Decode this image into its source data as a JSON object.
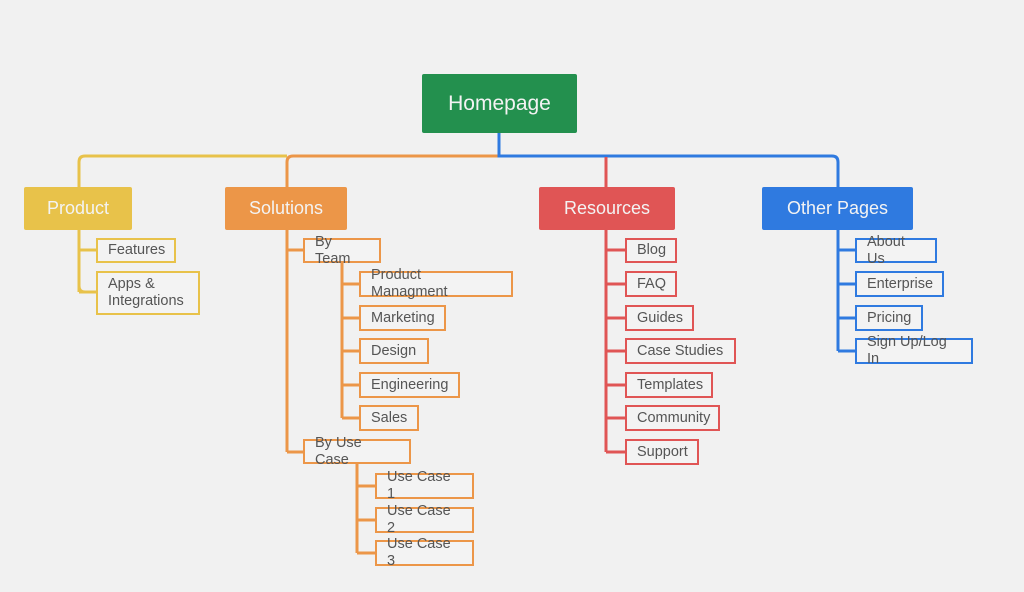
{
  "root": {
    "label": "Homepage",
    "color": "#23904e"
  },
  "branches": [
    {
      "label": "Product",
      "color": "#e8c24a",
      "children": [
        "Features",
        "Apps & Integrations"
      ]
    },
    {
      "label": "Solutions",
      "color": "#ec9648",
      "groups": [
        {
          "label": "By Team",
          "children": [
            "Product Managment",
            "Marketing",
            "Design",
            "Engineering",
            "Sales"
          ]
        },
        {
          "label": "By Use Case",
          "children": [
            "Use Case 1",
            "Use Case 2",
            "Use Case 3"
          ]
        }
      ]
    },
    {
      "label": "Resources",
      "color": "#e05555",
      "children": [
        "Blog",
        "FAQ",
        "Guides",
        "Case Studies",
        "Templates",
        "Community",
        "Support"
      ]
    },
    {
      "label": "Other Pages",
      "color": "#2f7ae0",
      "children": [
        "About Us",
        "Enterprise",
        "Pricing",
        "Sign Up/Log In"
      ]
    }
  ]
}
